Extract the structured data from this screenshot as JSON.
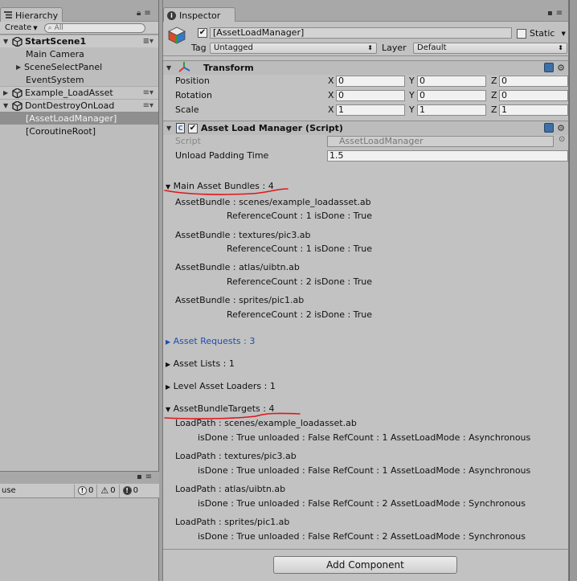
{
  "hierarchy": {
    "tab_label": "Hierarchy",
    "create_label": "Create",
    "search_placeholder": "All",
    "scenes": [
      {
        "name": "StartScene1",
        "children": [
          "Main Camera",
          "SceneSelectPanel",
          "EventSystem"
        ]
      },
      {
        "name": "Example_LoadAsset",
        "children": []
      },
      {
        "name": "DontDestroyOnLoad",
        "children": [
          "[AssetLoadManager]",
          "[CoroutineRoot]"
        ]
      }
    ]
  },
  "console": {
    "search_fragment": "use",
    "info_count": "0",
    "warn_count": "0",
    "error_count": "0"
  },
  "inspector": {
    "tab_label": "Inspector",
    "object_name": "[AssetLoadManager]",
    "static_label": "Static",
    "tag_label": "Tag",
    "tag_value": "Untagged",
    "layer_label": "Layer",
    "layer_value": "Default",
    "transform": {
      "title": "Transform",
      "rows": [
        {
          "label": "Position",
          "x": "0",
          "y": "0",
          "z": "0"
        },
        {
          "label": "Rotation",
          "x": "0",
          "y": "0",
          "z": "0"
        },
        {
          "label": "Scale",
          "x": "1",
          "y": "1",
          "z": "1"
        }
      ],
      "axis_x": "X",
      "axis_y": "Y",
      "axis_z": "Z"
    },
    "script": {
      "title": "Asset Load Manager (Script)",
      "script_label": "Script",
      "script_value": "AssetLoadManager",
      "padding_label": "Unload Padding Time",
      "padding_value": "1.5"
    },
    "main_bundles": {
      "header": "Main Asset Bundles : 4",
      "items": [
        {
          "bundle": "AssetBundle : scenes/example_loadasset.ab",
          "detail": "ReferenceCount : 1  isDone : True"
        },
        {
          "bundle": "AssetBundle : textures/pic3.ab",
          "detail": "ReferenceCount : 1  isDone : True"
        },
        {
          "bundle": "AssetBundle : atlas/uibtn.ab",
          "detail": "ReferenceCount : 2  isDone : True"
        },
        {
          "bundle": "AssetBundle : sprites/pic1.ab",
          "detail": "ReferenceCount : 2  isDone : True"
        }
      ]
    },
    "asset_requests": "Asset Requests : 3",
    "asset_lists": "Asset Lists : 1",
    "level_loaders": "Level Asset Loaders : 1",
    "targets": {
      "header": "AssetBundleTargets : 4",
      "items": [
        {
          "path": "LoadPath : scenes/example_loadasset.ab",
          "detail": "isDone : True  unloaded : False RefCount : 1 AssetLoadMode : Asynchronous"
        },
        {
          "path": "LoadPath : textures/pic3.ab",
          "detail": "isDone : True  unloaded : False RefCount : 1 AssetLoadMode : Asynchronous"
        },
        {
          "path": "LoadPath : atlas/uibtn.ab",
          "detail": "isDone : True  unloaded : False RefCount : 2 AssetLoadMode : Synchronous"
        },
        {
          "path": "LoadPath : sprites/pic1.ab",
          "detail": "isDone : True  unloaded : False RefCount : 2 AssetLoadMode : Synchronous"
        }
      ]
    },
    "add_component": "Add Component"
  },
  "colors": {
    "selection": "#8f8f8f",
    "link_blue": "#1d4db6",
    "annotation_red": "#e0161b"
  }
}
